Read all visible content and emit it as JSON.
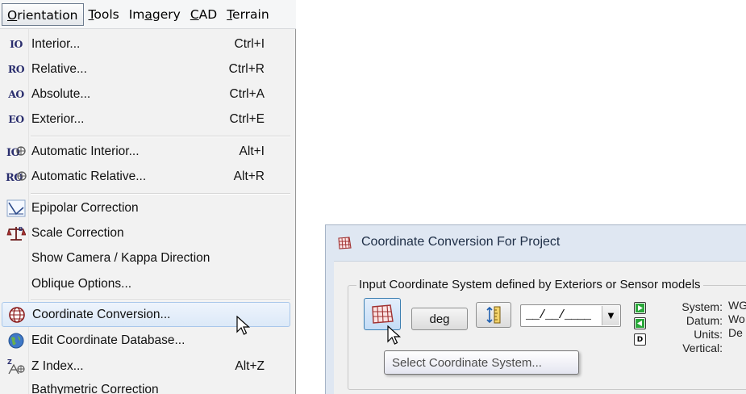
{
  "menubar": {
    "items": [
      {
        "label": "Orientation",
        "mnemonic_index": 0,
        "active": true
      },
      {
        "label": "Tools",
        "mnemonic_index": 0
      },
      {
        "label": "Imagery",
        "mnemonic_index": 2
      },
      {
        "label": "CAD",
        "mnemonic_index": 0
      },
      {
        "label": "Terrain",
        "mnemonic_index": 0
      }
    ]
  },
  "menu": {
    "interior": {
      "icon": "IO",
      "label": "Interior...",
      "shortcut": "Ctrl+I"
    },
    "relative": {
      "icon": "RO",
      "label": "Relative...",
      "shortcut": "Ctrl+R"
    },
    "absolute": {
      "icon": "AO",
      "label": "Absolute...",
      "shortcut": "Ctrl+A"
    },
    "exterior": {
      "icon": "EO",
      "label": "Exterior...",
      "shortcut": "Ctrl+E"
    },
    "auto_interior": {
      "icon": "auto-interior-icon",
      "label": "Automatic Interior...",
      "shortcut": "Alt+I"
    },
    "auto_relative": {
      "icon": "auto-relative-icon",
      "label": "Automatic Relative...",
      "shortcut": "Alt+R"
    },
    "epipolar": {
      "icon": "epipolar-icon",
      "label": "Epipolar Correction"
    },
    "scale": {
      "icon": "scale-balance-icon",
      "label": "Scale Correction"
    },
    "camera_kappa": {
      "label": "Show Camera / Kappa Direction"
    },
    "oblique": {
      "label": "Oblique Options..."
    },
    "coord_conv": {
      "icon": "globe-grid-icon",
      "label": "Coordinate Conversion...",
      "hovered": true
    },
    "edit_coord_db": {
      "icon": "globe-gear-icon",
      "label": "Edit Coordinate Database..."
    },
    "z_index": {
      "icon": "z-index-icon",
      "label": "Z Index...",
      "shortcut": "Alt+Z"
    },
    "bathymetric": {
      "label": "Bathymetric Correction"
    }
  },
  "dialog": {
    "title": "Coordinate Conversion For Project",
    "group_label": "Input Coordinate System defined by Exteriors or Sensor models",
    "deg_button": "deg",
    "combo_value": "__/__/____",
    "side_button_d": "D",
    "info": {
      "system_label": "System:",
      "system_value": "WG",
      "datum_label": "Datum:",
      "datum_value": "Wo",
      "units_label": "Units:",
      "units_value": "De",
      "vertical_label": "Vertical:",
      "vertical_value": ""
    },
    "tooltip": "Select Coordinate System..."
  },
  "colors": {
    "menu_background": "#f2f2f2",
    "hover_highlight": "#dce9f8",
    "dialog_frame": "#dfe7f2",
    "icon_text": "#2a2e6e",
    "green_arrow": "#2aa83a"
  }
}
